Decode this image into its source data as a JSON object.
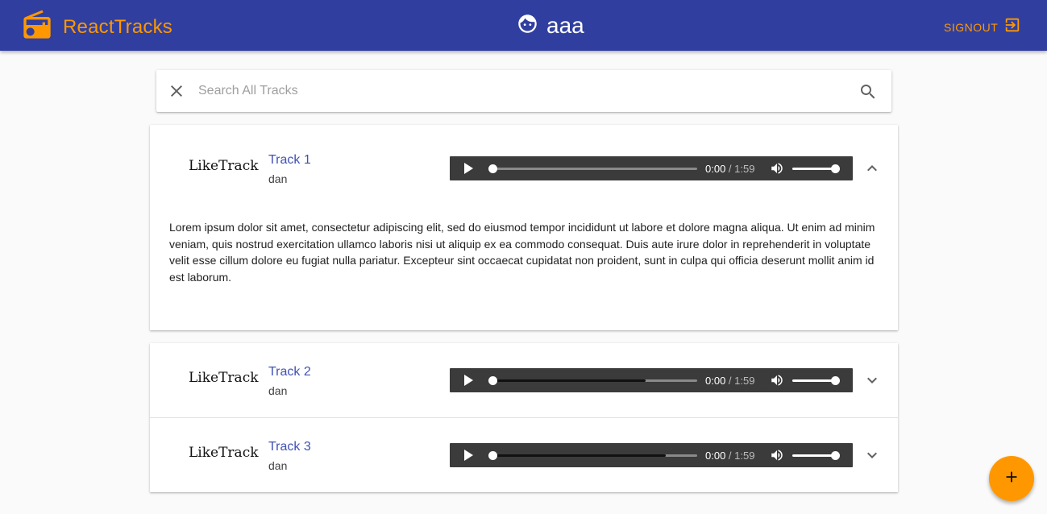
{
  "appbar": {
    "brand": "ReactTracks",
    "username": "aaa",
    "signout_label": "SIGNOUT",
    "accent": "#ff9800",
    "bar_color": "#303f9f"
  },
  "search": {
    "placeholder": "Search All Tracks",
    "value": ""
  },
  "tracks": [
    {
      "like_label": "LikeTrack",
      "title": "Track 1",
      "artist": "dan",
      "current_time": "0:00",
      "separator": " / ",
      "duration": "1:59",
      "expanded": true,
      "description": "Lorem ipsum dolor sit amet, consectetur adipiscing elit, sed do eiusmod tempor incididunt ut labore et dolore magna aliqua. Ut enim ad minim veniam, quis nostrud exercitation ullamco laboris nisi ut aliquip ex ea commodo consequat. Duis aute irure dolor in reprehenderit in voluptate velit esse cillum dolore eu fugiat nulla pariatur. Excepteur sint occaecat cupidatat non proident, sunt in culpa qui officia deserunt mollit anim id est laborum.",
      "buffered_fraction": 0,
      "volume_fraction": 1
    },
    {
      "like_label": "LikeTrack",
      "title": "Track 2",
      "artist": "dan",
      "current_time": "0:00",
      "separator": " / ",
      "duration": "1:59",
      "expanded": false,
      "buffered_fraction": 0.75,
      "volume_fraction": 1
    },
    {
      "like_label": "LikeTrack",
      "title": "Track 3",
      "artist": "dan",
      "current_time": "0:00",
      "separator": " / ",
      "duration": "1:59",
      "expanded": false,
      "buffered_fraction": 0.85,
      "volume_fraction": 1
    }
  ],
  "icons": {
    "brand": "radio-icon",
    "user": "face-icon",
    "signout": "exit-to-app-icon",
    "clear": "close-icon",
    "search": "search-icon",
    "play": "play-icon",
    "mute": "volume-icon",
    "expand": "chevron-down-icon",
    "collapse": "chevron-up-icon",
    "add": "plus-icon"
  }
}
